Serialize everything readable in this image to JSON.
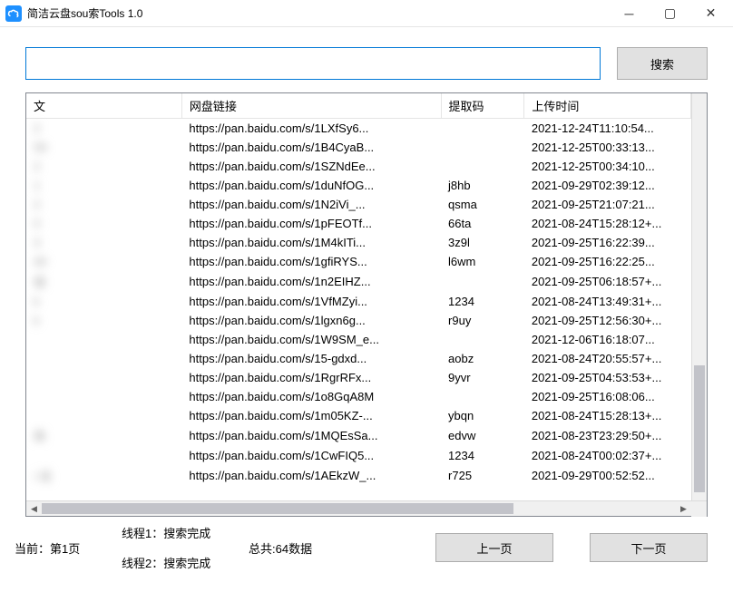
{
  "window": {
    "title": "简洁云盘sou索Tools 1.0"
  },
  "search": {
    "value": "",
    "button": "搜索"
  },
  "columns": {
    "name": "文",
    "link": "网盘链接",
    "code": "提取码",
    "time": "上传时间"
  },
  "rows": [
    {
      "name": "2",
      "link": "https://pan.baidu.com/s/1LXfSy6...",
      "code": "",
      "time": "2021-12-24T11:10:54..."
    },
    {
      "name": "59",
      "link": "https://pan.baidu.com/s/1B4CyaB...",
      "code": "",
      "time": "2021-12-25T00:33:13..."
    },
    {
      "name": "2",
      "link": "https://pan.baidu.com/s/1SZNdEe...",
      "code": "",
      "time": "2021-12-25T00:34:10..."
    },
    {
      "name": "1",
      "link": "https://pan.baidu.com/s/1duNfOG...",
      "code": "j8hb",
      "time": "2021-09-29T02:39:12..."
    },
    {
      "name": "2",
      "link": "https://pan.baidu.com/s/1N2iVi_...",
      "code": "qsma",
      "time": "2021-09-25T21:07:21..."
    },
    {
      "name": "0",
      "link": "https://pan.baidu.com/s/1pFEOTf...",
      "code": "66ta",
      "time": "2021-08-24T15:28:12+..."
    },
    {
      "name": "3",
      "link": "https://pan.baidu.com/s/1M4kITi...",
      "code": "3z9l",
      "time": "2021-09-25T16:22:39..."
    },
    {
      "name": "40",
      "link": "https://pan.baidu.com/s/1gfiRYS...",
      "code": "l6wm",
      "time": "2021-09-25T16:22:25..."
    },
    {
      "name": "弱",
      "link": "https://pan.baidu.com/s/1n2EIHZ...",
      "code": "",
      "time": "2021-09-25T06:18:57+..."
    },
    {
      "name": "k",
      "link": "https://pan.baidu.com/s/1VfMZyi...",
      "code": "1234",
      "time": "2021-08-24T13:49:31+..."
    },
    {
      "name": "k",
      "link": "https://pan.baidu.com/s/1lgxn6g...",
      "code": "r9uy",
      "time": "2021-09-25T12:56:30+..."
    },
    {
      "name": "",
      "link": "https://pan.baidu.com/s/1W9SM_e...",
      "code": "",
      "time": "2021-12-06T16:18:07..."
    },
    {
      "name": "",
      "link": "https://pan.baidu.com/s/15-gdxd...",
      "code": "aobz",
      "time": "2021-08-24T20:55:57+..."
    },
    {
      "name": "",
      "link": "https://pan.baidu.com/s/1RgrRFx...",
      "code": "9yvr",
      "time": "2021-09-25T04:53:53+..."
    },
    {
      "name": "",
      "link": "https://pan.baidu.com/s/1o8GqA8M",
      "code": "",
      "time": "2021-09-25T16:08:06..."
    },
    {
      "name": "",
      "link": "https://pan.baidu.com/s/1m05KZ-...",
      "code": "ybqn",
      "time": "2021-08-24T15:28:13+..."
    },
    {
      "name": "简",
      "link": "https://pan.baidu.com/s/1MQEsSa...",
      "code": "edvw",
      "time": "2021-08-23T23:29:50+..."
    },
    {
      "name": "",
      "link": "https://pan.baidu.com/s/1CwFIQ5...",
      "code": "1234",
      "time": "2021-08-24T00:02:37+..."
    },
    {
      "name": "i    话",
      "link": "https://pan.baidu.com/s/1AEkzW_...",
      "code": "r725",
      "time": "2021-09-29T00:52:52..."
    }
  ],
  "status": {
    "current_page": "当前：第1页",
    "thread1": "线程1：搜索完成",
    "thread2": "线程2：搜索完成",
    "total": "总共:64数据"
  },
  "paging": {
    "prev": "上一页",
    "next": "下一页"
  }
}
